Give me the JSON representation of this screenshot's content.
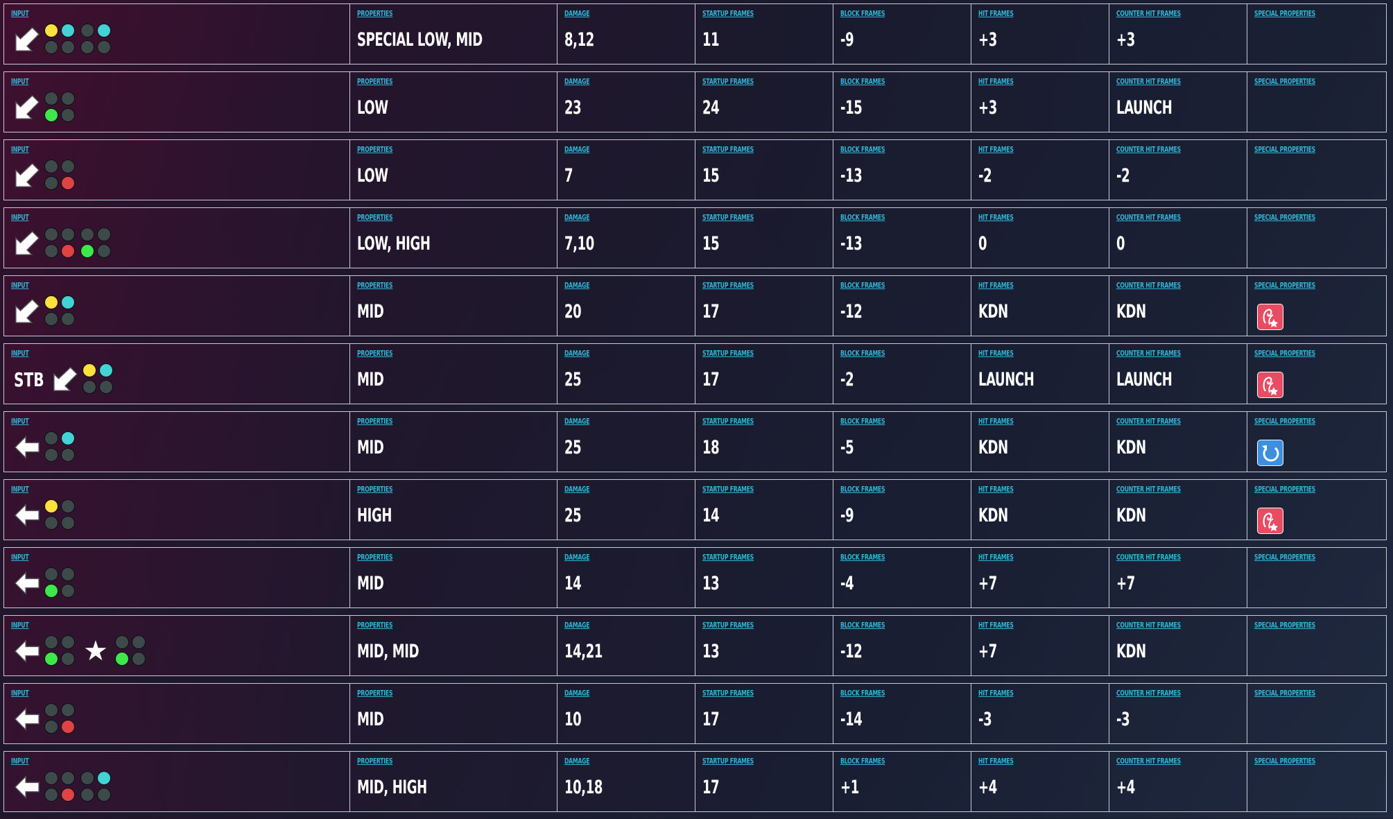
{
  "labels": {
    "input": "INPUT",
    "properties": "PROPERTIES",
    "damage": "DAMAGE",
    "startup": "STARTUP FRAMES",
    "block": "BLOCK FRAMES",
    "hit": "HIT FRAMES",
    "counter": "COUNTER HIT FRAMES",
    "special": "SPECIAL PROPERTIES"
  },
  "colors": {
    "label": "#2fb6d6",
    "button_1": "#ffe03d",
    "button_2": "#43d3d6",
    "button_3": "#3fe84a",
    "button_4": "#e04343",
    "heat_icon": "#e94b63",
    "tornado_icon": "#3d8fe0"
  },
  "rows": [
    {
      "input": {
        "prefix": "",
        "direction": "down-back-arrow",
        "groups": [
          [
            1,
            2
          ],
          [
            2
          ]
        ]
      },
      "properties": "SPECIAL LOW, MID",
      "damage": "8,12",
      "startup": "11",
      "block": "-9",
      "hit": "+3",
      "counter": "+3",
      "special": ""
    },
    {
      "input": {
        "prefix": "",
        "direction": "down-back-arrow",
        "groups": [
          [
            3
          ]
        ]
      },
      "properties": "LOW",
      "damage": "23",
      "startup": "24",
      "block": "-15",
      "hit": "+3",
      "counter": "LAUNCH",
      "special": ""
    },
    {
      "input": {
        "prefix": "",
        "direction": "down-back-arrow",
        "groups": [
          [
            4
          ]
        ]
      },
      "properties": "LOW",
      "damage": "7",
      "startup": "15",
      "block": "-13",
      "hit": "-2",
      "counter": "-2",
      "special": ""
    },
    {
      "input": {
        "prefix": "",
        "direction": "down-back-arrow",
        "groups": [
          [
            4
          ],
          [
            3
          ]
        ]
      },
      "properties": "LOW, HIGH",
      "damage": "7,10",
      "startup": "15",
      "block": "-13",
      "hit": "0",
      "counter": "0",
      "special": ""
    },
    {
      "input": {
        "prefix": "",
        "direction": "down-back-arrow",
        "groups": [
          [
            1,
            2
          ]
        ]
      },
      "properties": "MID",
      "damage": "20",
      "startup": "17",
      "block": "-12",
      "hit": "KDN",
      "counter": "KDN",
      "special": "heat-engager-icon"
    },
    {
      "input": {
        "prefix": "STB",
        "direction": "down-back-arrow",
        "groups": [
          [
            1,
            2
          ]
        ]
      },
      "properties": "MID",
      "damage": "25",
      "startup": "17",
      "block": "-2",
      "hit": "LAUNCH",
      "counter": "LAUNCH",
      "special": "heat-engager-icon"
    },
    {
      "input": {
        "prefix": "",
        "direction": "back-arrow",
        "groups": [
          [
            2
          ]
        ]
      },
      "properties": "MID",
      "damage": "25",
      "startup": "18",
      "block": "-5",
      "hit": "KDN",
      "counter": "KDN",
      "special": "tornado-icon"
    },
    {
      "input": {
        "prefix": "",
        "direction": "back-arrow",
        "groups": [
          [
            1
          ]
        ]
      },
      "properties": "HIGH",
      "damage": "25",
      "startup": "14",
      "block": "-9",
      "hit": "KDN",
      "counter": "KDN",
      "special": "heat-engager-icon"
    },
    {
      "input": {
        "prefix": "",
        "direction": "back-arrow",
        "groups": [
          [
            3
          ]
        ]
      },
      "properties": "MID",
      "damage": "14",
      "startup": "13",
      "block": "-4",
      "hit": "+7",
      "counter": "+7",
      "special": ""
    },
    {
      "input": {
        "prefix": "",
        "direction": "back-arrow",
        "groups": [
          [
            3
          ],
          "star",
          [
            3
          ]
        ]
      },
      "properties": "MID, MID",
      "damage": "14,21",
      "startup": "13",
      "block": "-12",
      "hit": "+7",
      "counter": "KDN",
      "special": ""
    },
    {
      "input": {
        "prefix": "",
        "direction": "back-arrow",
        "groups": [
          [
            4
          ]
        ]
      },
      "properties": "MID",
      "damage": "10",
      "startup": "17",
      "block": "-14",
      "hit": "-3",
      "counter": "-3",
      "special": ""
    },
    {
      "input": {
        "prefix": "",
        "direction": "back-arrow",
        "groups": [
          [
            4
          ],
          [
            2
          ]
        ]
      },
      "properties": "MID, HIGH",
      "damage": "10,18",
      "startup": "17",
      "block": "+1",
      "hit": "+4",
      "counter": "+4",
      "special": ""
    }
  ]
}
